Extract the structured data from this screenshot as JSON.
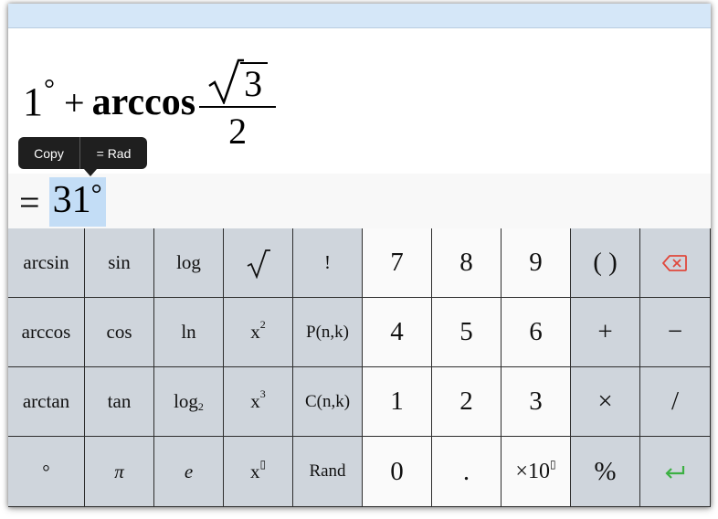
{
  "expression": {
    "term1_value": "1",
    "term1_unit": "°",
    "operator": "+",
    "function": "arccos",
    "numerator_radicand": "3",
    "denominator": "2"
  },
  "result": {
    "equals": "=",
    "value": "31",
    "unit": "°"
  },
  "popup": {
    "copy_label": "Copy",
    "rad_label": "= Rad"
  },
  "keys": {
    "arcsin": "arcsin",
    "sin": "sin",
    "log": "log",
    "factorial": "!",
    "seven": "7",
    "eight": "8",
    "nine": "9",
    "parens": "( )",
    "arccos": "arccos",
    "cos": "cos",
    "ln": "ln",
    "x_base": "x",
    "square_exp": "2",
    "cube_exp": "3",
    "pow_exp": "▯",
    "perm": "P(n,k)",
    "four": "4",
    "five": "5",
    "six": "6",
    "plus": "+",
    "minus": "−",
    "arctan": "arctan",
    "tan": "tan",
    "log2_base": "log",
    "log2_sub": "2",
    "comb": "C(n,k)",
    "one": "1",
    "two": "2",
    "three": "3",
    "times": "×",
    "divide": "/",
    "degree": "°",
    "pi": "π",
    "e": "e",
    "rand": "Rand",
    "zero": "0",
    "dot": ".",
    "sci_base": "×10",
    "sci_exp": "▯",
    "percent": "%"
  },
  "colors": {
    "titlebar": "#d5e7f8",
    "function_key": "#cfd5dc",
    "number_key": "#fafafa",
    "selection": "#c3ddf6",
    "backspace": "#e0483c",
    "enter": "#3cb043"
  },
  "icons": {
    "backspace": "backspace-icon",
    "enter": "enter-icon",
    "sqrt": "square-root-icon"
  }
}
